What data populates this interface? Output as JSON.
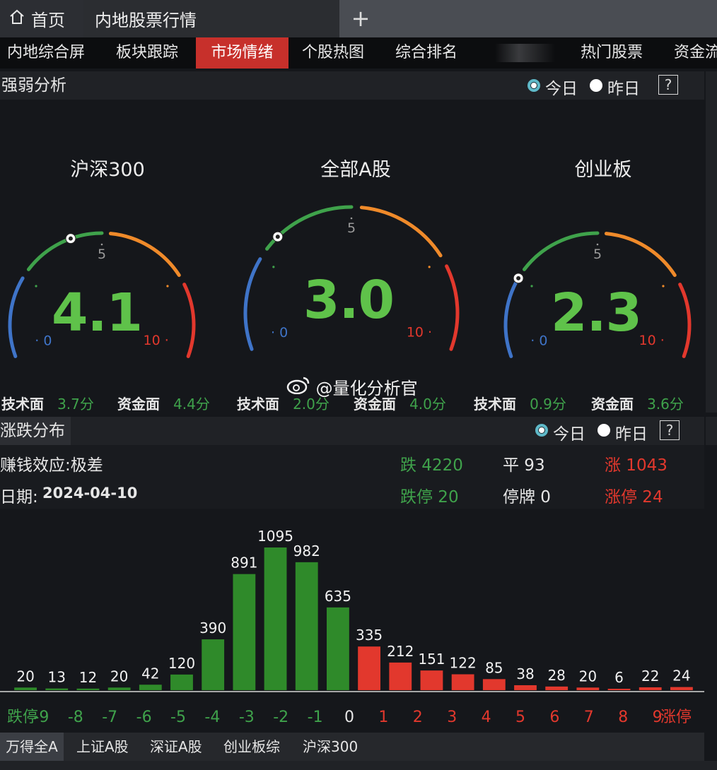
{
  "tabs": {
    "home": "首页",
    "active": "内地股票行情",
    "plus": "+"
  },
  "nav": [
    "内地综合屏",
    "板块跟踪",
    "市场情绪",
    "个股热图",
    "综合排名",
    "热门股票",
    "资金流"
  ],
  "strength": {
    "title": "强弱分析",
    "today": "今日",
    "yesterday": "昨日",
    "help": "?",
    "gauges": [
      {
        "name": "沪深300",
        "value": "4.1",
        "score": 4.1,
        "tech_label": "技术面",
        "tech": "3.7分",
        "fund_label": "资金面",
        "fund": "4.4分"
      },
      {
        "name": "全部A股",
        "value": "3.0",
        "score": 3.0,
        "tech_label": "技术面",
        "tech": "2.0分",
        "fund_label": "资金面",
        "fund": "4.0分"
      },
      {
        "name": "创业板",
        "value": "2.3",
        "score": 2.3,
        "tech_label": "技术面",
        "tech": "0.9分",
        "fund_label": "资金面",
        "fund": "3.6分"
      }
    ],
    "scale_min": "0",
    "scale_mid": "5",
    "scale_max": "10"
  },
  "distribution": {
    "title": "涨跌分布",
    "today": "今日",
    "yesterday": "昨日",
    "help": "?",
    "effect": "赚钱效应:极差",
    "date_label": "日期:",
    "date": "2024-04-10",
    "down": "跌 4220",
    "flat": "平 93",
    "up": "涨 1043",
    "limit_down": "跌停 20",
    "suspended": "停牌 0",
    "limit_up": "涨停 24"
  },
  "chart_data": {
    "type": "bar",
    "categories": [
      "跌停",
      "-9",
      "-8",
      "-7",
      "-6",
      "-5",
      "-4",
      "-3",
      "-2",
      "-1",
      "0",
      "1",
      "2",
      "3",
      "4",
      "5",
      "6",
      "7",
      "8",
      "9",
      "涨停"
    ],
    "values": [
      20,
      13,
      12,
      20,
      42,
      120,
      390,
      891,
      1095,
      982,
      635,
      335,
      212,
      151,
      122,
      85,
      38,
      28,
      20,
      6,
      22,
      24
    ],
    "bar_labels": [
      "20",
      "13",
      "12",
      "20",
      "42",
      "120",
      "390",
      "891",
      "1095",
      "982",
      "635",
      "335",
      "212",
      "151",
      "122",
      "85",
      "38",
      "28",
      "20",
      "6",
      "22",
      "24"
    ],
    "colors": {
      "down": "#2f8a2a",
      "up": "#e2382d"
    }
  },
  "bottom_tabs": [
    "万得全A",
    "上证A股",
    "深证A股",
    "创业板综",
    "沪深300"
  ],
  "watermark": "@量化分析官",
  "colors": {
    "green": "#5fc24a",
    "red": "#e2382d",
    "orange": "#ef8a2a",
    "blue": "#3f74c8"
  }
}
